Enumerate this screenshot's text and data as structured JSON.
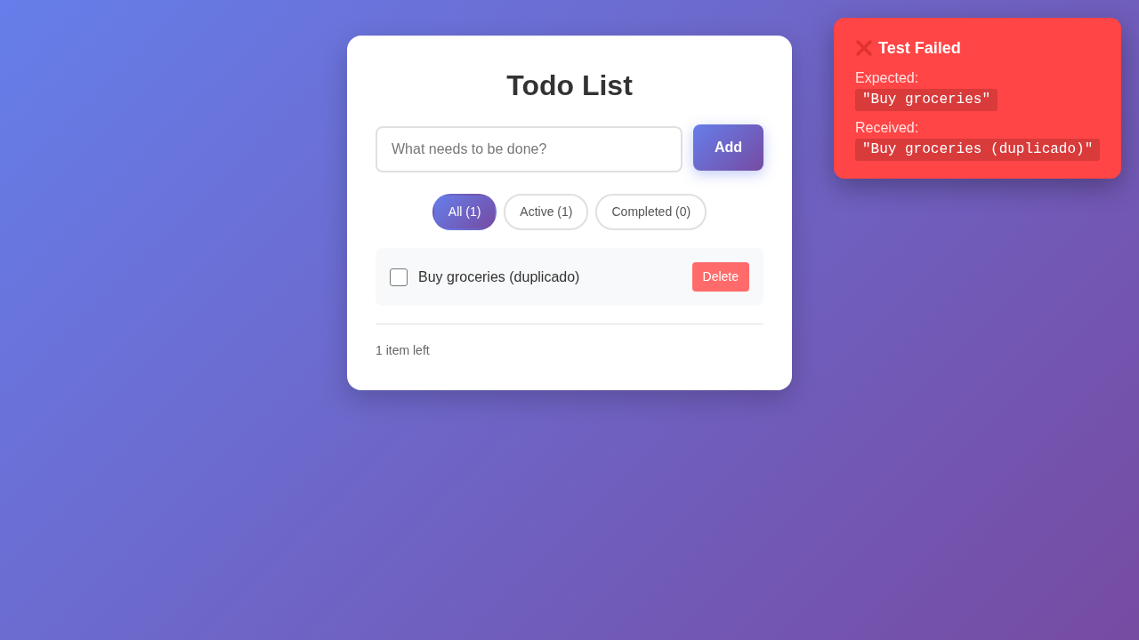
{
  "card": {
    "title": "Todo List",
    "input": {
      "placeholder": "What needs to be done?"
    },
    "add_button": "Add",
    "filters": [
      {
        "label": "All (1)",
        "selected": true
      },
      {
        "label": "Active (1)",
        "selected": false
      },
      {
        "label": "Completed (0)",
        "selected": false
      }
    ],
    "todos": [
      {
        "text": "Buy groceries (duplicado)",
        "checked": false,
        "delete_label": "Delete"
      }
    ],
    "footer": "1 item left"
  },
  "toast": {
    "title": "Test Failed",
    "fields": [
      {
        "label": "Expected:",
        "value": "\"Buy groceries\""
      },
      {
        "label": "Received:",
        "value": "\"Buy groceries (duplicado)\""
      }
    ]
  }
}
